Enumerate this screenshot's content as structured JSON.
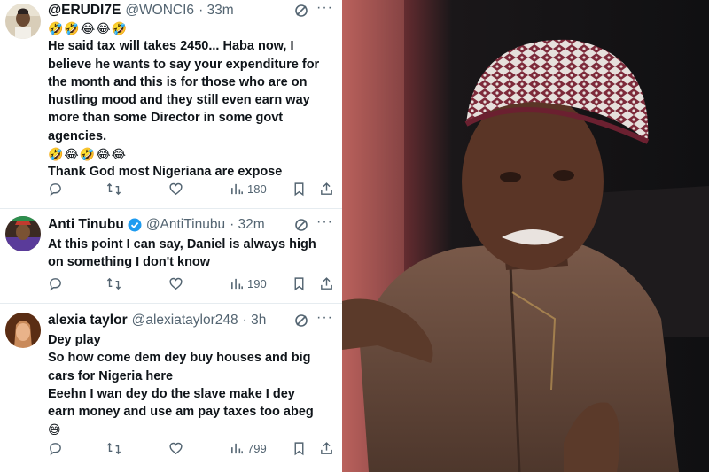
{
  "tweets": [
    {
      "display_name": "@ERUDI7E",
      "handle": "@WONCI6",
      "time": "· 33m",
      "verified": false,
      "lines": [
        "🤣🤣😂😂🤣",
        "He said tax will takes 2450... Haba now, I",
        "believe he wants to say your expenditure for",
        "the month and this is for those who are on",
        "hustling mood and they still even earn way",
        "more than some Director in some govt",
        "agencies.",
        "🤣😂🤣😂😂",
        "Thank God most Nigeriana are expose"
      ],
      "views": "180"
    },
    {
      "display_name": "Anti Tinubu",
      "handle": "@AntiTinubu",
      "time": "· 32m",
      "verified": true,
      "lines": [
        "At this point I can say,  Daniel is always high",
        "on something I don't know"
      ],
      "views": "190"
    },
    {
      "display_name": "alexia taylor",
      "handle": "@alexiataylor248",
      "time": "· 3h",
      "verified": false,
      "lines": [
        "Dey play",
        "So how come dem dey buy houses and big",
        "cars for Nigeria here",
        "Eeehn I wan dey do the slave make I dey",
        "earn money and use am pay taxes too abeg",
        "😅"
      ],
      "views": "799"
    }
  ],
  "icons": {
    "more": "···",
    "reply": "reply-icon",
    "retweet": "retweet-icon",
    "like": "like-icon",
    "views": "views-icon",
    "bookmark": "bookmark-icon",
    "share": "share-icon",
    "grok": "grok-icon"
  },
  "colors": {
    "text": "#0f1419",
    "muted": "#536471",
    "verified": "#1d9bf0",
    "divider": "#e6ecf0"
  }
}
